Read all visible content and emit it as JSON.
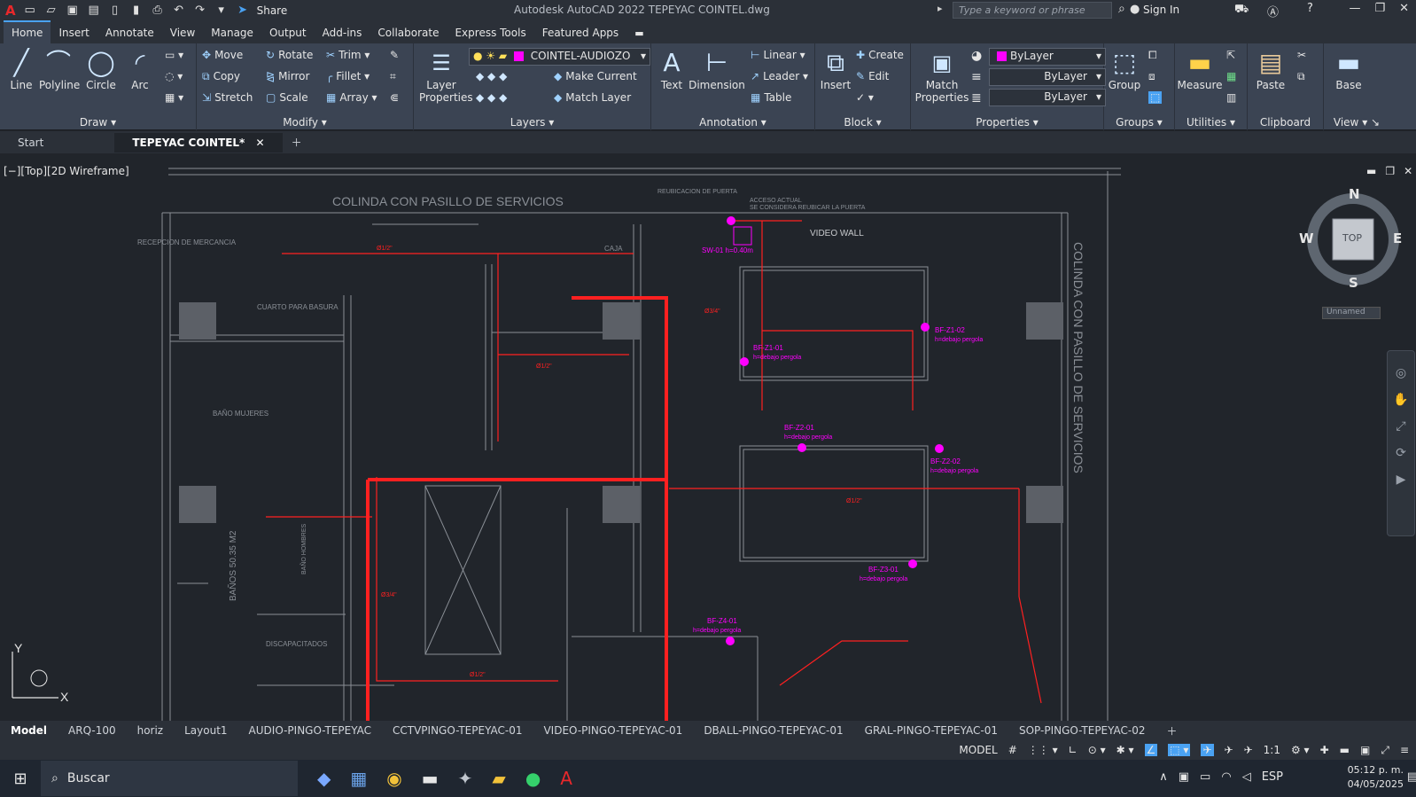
{
  "titlebar": {
    "app": "A",
    "share": "Share",
    "title": "Autodesk AutoCAD 2022    TEPEYAC COINTEL.dwg",
    "search_placeholder": "Type a keyword or phrase",
    "signin": "Sign In"
  },
  "ribbon_tabs": [
    "Home",
    "Insert",
    "Annotate",
    "View",
    "Manage",
    "Output",
    "Add-ins",
    "Collaborate",
    "Express Tools",
    "Featured Apps"
  ],
  "draw": {
    "title": "Draw",
    "line": "Line",
    "polyline": "Polyline",
    "circle": "Circle",
    "arc": "Arc"
  },
  "modify": {
    "title": "Modify",
    "move": "Move",
    "rotate": "Rotate",
    "trim": "Trim",
    "copy": "Copy",
    "mirror": "Mirror",
    "fillet": "Fillet",
    "stretch": "Stretch",
    "scale": "Scale",
    "array": "Array"
  },
  "layers": {
    "title": "Layers",
    "properties": "Layer Properties",
    "current_layer": "COINTEL-AUDIOZO",
    "make_current": "Make Current",
    "match_layer": "Match Layer"
  },
  "annotation": {
    "title": "Annotation",
    "text": "Text",
    "dimension": "Dimension",
    "linear": "Linear",
    "leader": "Leader",
    "table": "Table"
  },
  "block": {
    "title": "Block",
    "insert": "Insert",
    "create": "Create",
    "edit": "Edit"
  },
  "properties": {
    "title": "Properties",
    "match": "Match Properties",
    "color": "ByLayer",
    "linetype": "ByLayer",
    "lineweight": "ByLayer"
  },
  "groups": {
    "title": "Groups",
    "group": "Group"
  },
  "utilities": {
    "title": "Utilities",
    "measure": "Measure"
  },
  "clipboard": {
    "title": "Clipboard",
    "paste": "Paste"
  },
  "view_panel": {
    "title": "View",
    "base": "Base"
  },
  "file_tabs": {
    "start": "Start",
    "active": "TEPEYAC COINTEL*"
  },
  "viewport_label": "[−][Top][2D Wireframe]",
  "drawing": {
    "top_label": "COLINDA CON PASILLO DE SERVICIOS",
    "side_label": "COLINDA CON PASILLO DE SERVICIOS",
    "video_wall": "VIDEO WALL",
    "reubicacion": "REUBICACION DE PUERTA",
    "acceso": "ACCESO ACTUAL",
    "acceso2": "SE CONSIDERA REUBICAR LA PUERTA",
    "recepcion": "RECEPCION DE MERCANCIA",
    "basura": "CUARTO PARA BASURA",
    "mujeres": "BAÑO MUJERES",
    "hombres": "BAÑO HOMBRES",
    "banos": "BAÑOS 50.35 M2",
    "discap": "DISCAPACITADOS",
    "caja": "CAJA",
    "sw": "SW-01 h=0.40m",
    "bf1": "BF-Z1-01",
    "bf2": "BF-Z1-02",
    "bf3": "BF-Z2-01",
    "bf4": "BF-Z2-02",
    "bf5": "BF-Z3-01",
    "bf6": "BF-Z4-01",
    "pergola": "h=debajo pergola",
    "pipe": "Ø1/2\"",
    "pipe34": "Ø3/4\""
  },
  "viewcube": {
    "n": "N",
    "s": "S",
    "e": "E",
    "w": "W",
    "face": "TOP",
    "ucs": "Unnamed"
  },
  "layout_tabs": [
    "Model",
    "ARQ-100",
    "horiz",
    "Layout1",
    "AUDIO-PINGO-TEPEYAC",
    "CCTVPINGO-TEPEYAC-01",
    "VIDEO-PINGO-TEPEYAC-01",
    "DBALL-PINGO-TEPEYAC-01",
    "GRAL-PINGO-TEPEYAC-01",
    "SOP-PINGO-TEPEYAC-02"
  ],
  "status": {
    "model": "MODEL",
    "scale": "1:1"
  },
  "taskbar": {
    "search": "Buscar",
    "lang": "ESP",
    "time": "05:12 p. m.",
    "date": "04/05/2025"
  },
  "colors": {
    "accent": "#4aa2f2",
    "wire": "#ff2020",
    "device": "#ff00ff",
    "background": "#21252b"
  }
}
